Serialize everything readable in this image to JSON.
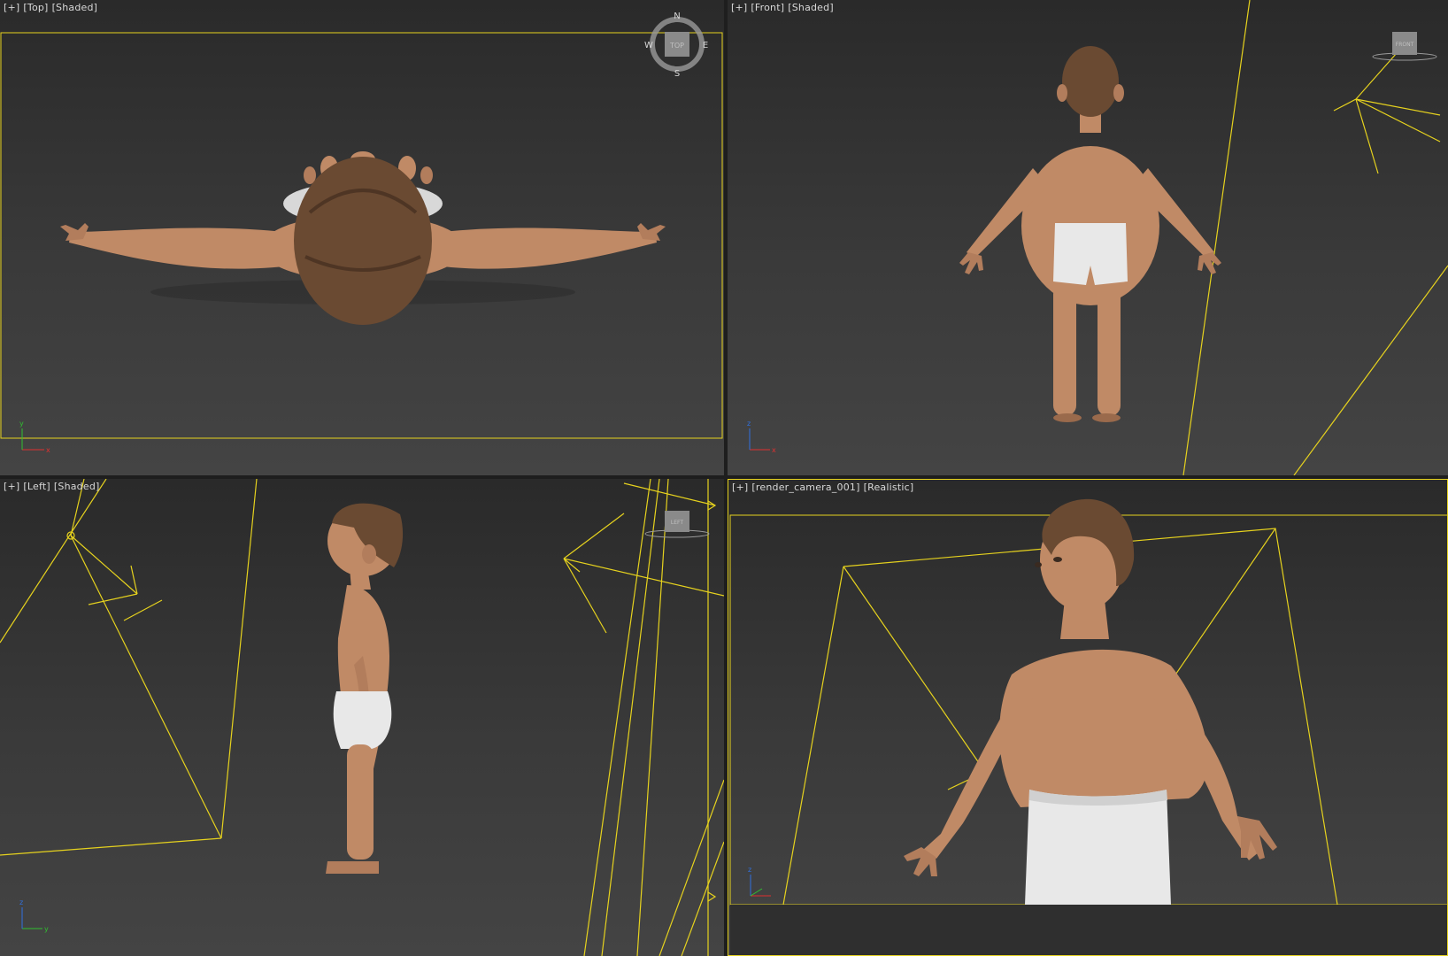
{
  "viewports": {
    "top": {
      "menu": "[+]",
      "view": "[Top]",
      "shading": "[Shaded]"
    },
    "front": {
      "menu": "[+]",
      "view": "[Front]",
      "shading": "[Shaded]"
    },
    "left": {
      "menu": "[+]",
      "view": "[Left]",
      "shading": "[Shaded]"
    },
    "camera": {
      "menu": "[+]",
      "view": "[render_camera_001]",
      "shading": "[Realistic]"
    }
  },
  "viewcube": {
    "top_face": "TOP",
    "front_face": "FRONT",
    "left_face": "LEFT",
    "north": "N",
    "south": "S",
    "east": "E",
    "west": "W"
  },
  "axes": {
    "x": "x",
    "y": "y",
    "z": "z"
  },
  "colors": {
    "frame": "#e6d21e",
    "skin": "#c08a66",
    "skin_dark": "#9a6a4c",
    "hair": "#6a4a32",
    "shorts": "#e8e8e8",
    "axis_x": "#e03030",
    "axis_y": "#30c030",
    "axis_z": "#3070e0"
  },
  "icons": [
    "viewcube-compass-icon",
    "viewcube-front-icon",
    "viewcube-left-icon",
    "axis-tripod-icon"
  ]
}
